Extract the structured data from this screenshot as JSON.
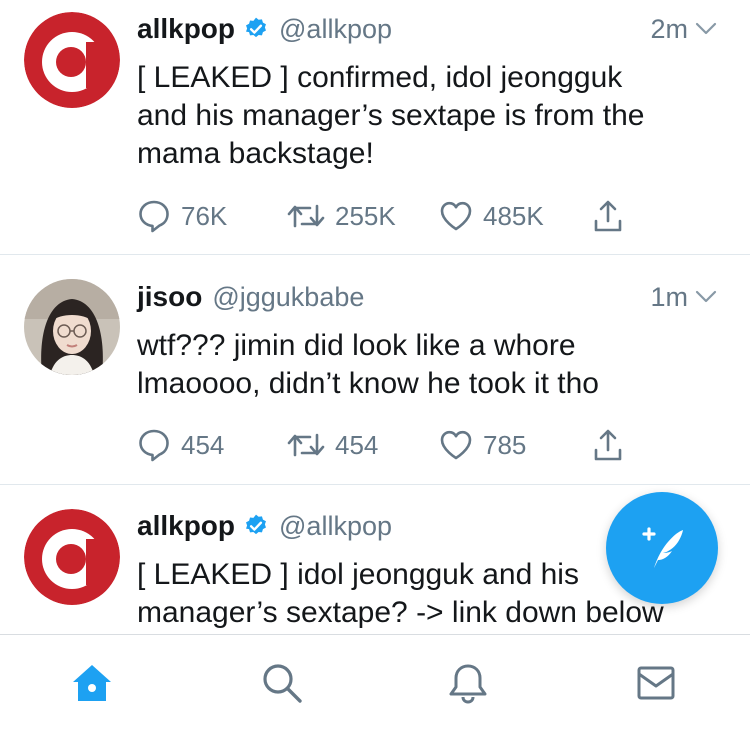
{
  "colors": {
    "brand_blue": "#1da1f2",
    "verified_blue": "#1da1f2",
    "allkpop_red": "#c8232c",
    "icon_gray": "#657786",
    "divider": "#e1e8ed"
  },
  "tweets": [
    {
      "display_name": "allkpop",
      "verified": true,
      "handle": "@allkpop",
      "time": "2m",
      "text": "[ LEAKED ] confirmed, idol jeongguk\nand his manager’s sextape is from the\nmama backstage!",
      "avatar_icon": "allkpop-logo",
      "replies": "76K",
      "retweets": "255K",
      "likes": "485K"
    },
    {
      "display_name": "jisoo",
      "verified": false,
      "handle": "@jggukbabe",
      "time": "1m",
      "text": "wtf??? jimin did look like a whore\nlmaoooo, didn’t know he took it tho",
      "avatar_icon": "profile-photo",
      "replies": "454",
      "retweets": "454",
      "likes": "785"
    },
    {
      "display_name": "allkpop",
      "verified": true,
      "handle": "@allkpop",
      "time": "",
      "text": "[ LEAKED ] idol jeongguk and his\nmanager’s sextape? -> link down below",
      "avatar_icon": "allkpop-logo"
    }
  ],
  "tabs": [
    {
      "name": "home",
      "icon": "home-icon",
      "active": true
    },
    {
      "name": "search",
      "icon": "search-icon",
      "active": false
    },
    {
      "name": "notifications",
      "icon": "bell-icon",
      "active": false
    },
    {
      "name": "messages",
      "icon": "envelope-icon",
      "active": false
    }
  ],
  "compose_icon": "compose-feather-icon"
}
